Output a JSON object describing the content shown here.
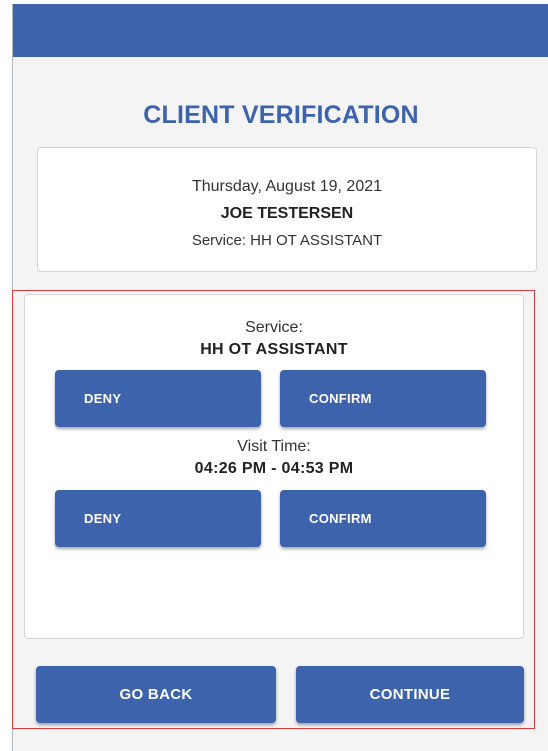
{
  "header": {
    "title": "CLIENT VERIFICATION"
  },
  "visit_info": {
    "date": "Thursday, August 19, 2021",
    "client_name": "JOE TESTERSEN",
    "service_line": "Service: HH OT ASSISTANT"
  },
  "service_section": {
    "label": "Service:",
    "value": "HH OT ASSISTANT",
    "deny_label": "DENY",
    "confirm_label": "CONFIRM"
  },
  "visit_time_section": {
    "label": "Visit Time:",
    "value": "04:26 PM - 04:53 PM",
    "deny_label": "DENY",
    "confirm_label": "CONFIRM"
  },
  "footer": {
    "back_label": "GO BACK",
    "continue_label": "CONTINUE"
  },
  "colors": {
    "primary": "#3d63ad",
    "highlight": "#e03a3a",
    "background": "#f4f4f5"
  }
}
